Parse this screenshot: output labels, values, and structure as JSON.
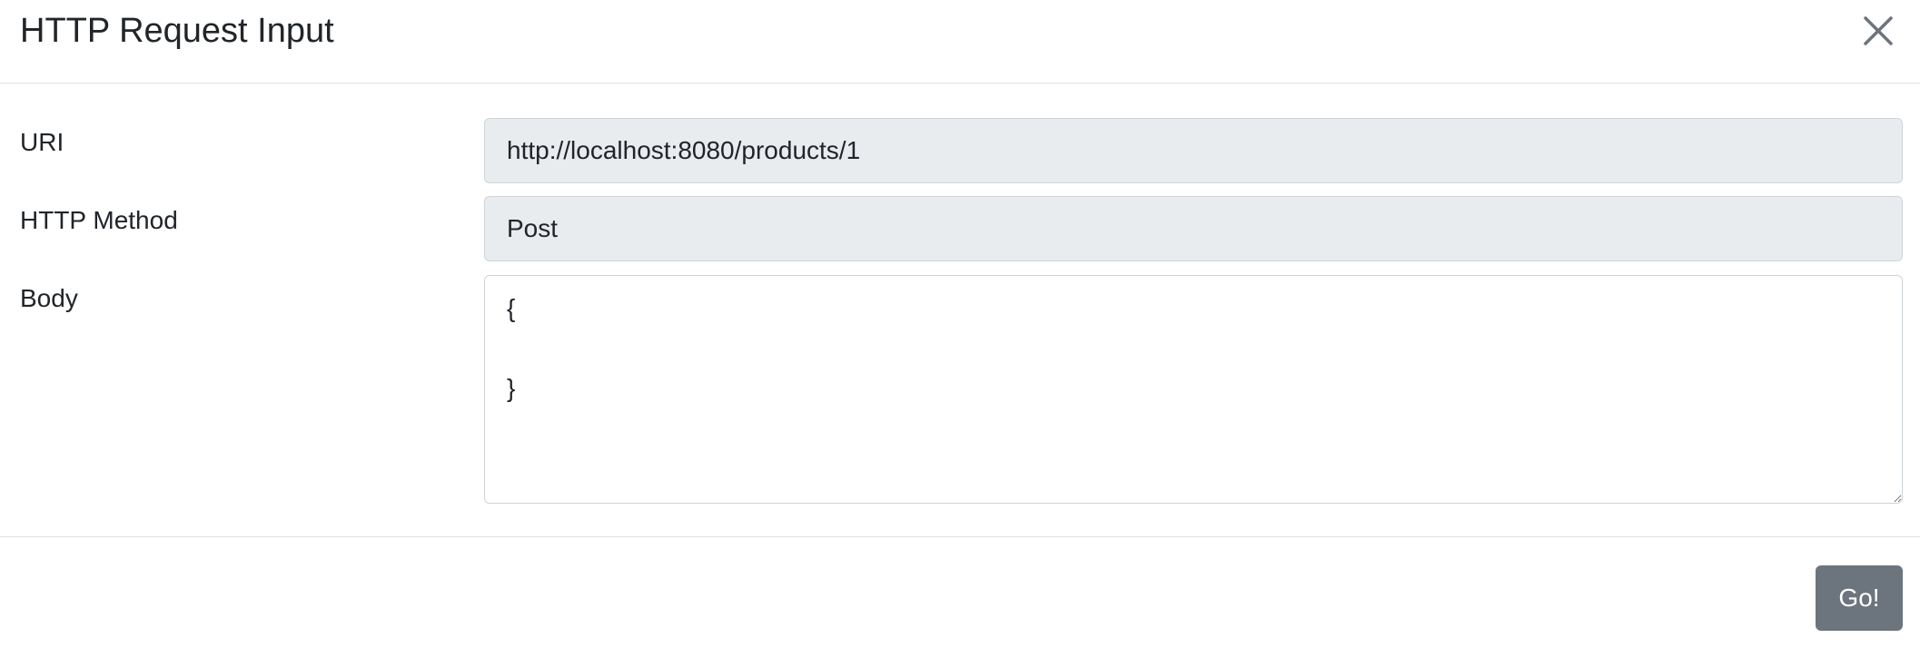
{
  "modal": {
    "title": "HTTP Request Input",
    "close_icon": "close-icon"
  },
  "form": {
    "uri": {
      "label": "URI",
      "value": "http://localhost:8080/products/1"
    },
    "method": {
      "label": "HTTP Method",
      "value": "Post"
    },
    "body": {
      "label": "Body",
      "value": "{\n\n}"
    }
  },
  "footer": {
    "go_label": "Go!"
  },
  "colors": {
    "readonly_bg": "#e9ecef",
    "border": "#ced4da",
    "divider": "#dee2e6",
    "secondary_button": "#6c757d",
    "text": "#212529"
  }
}
